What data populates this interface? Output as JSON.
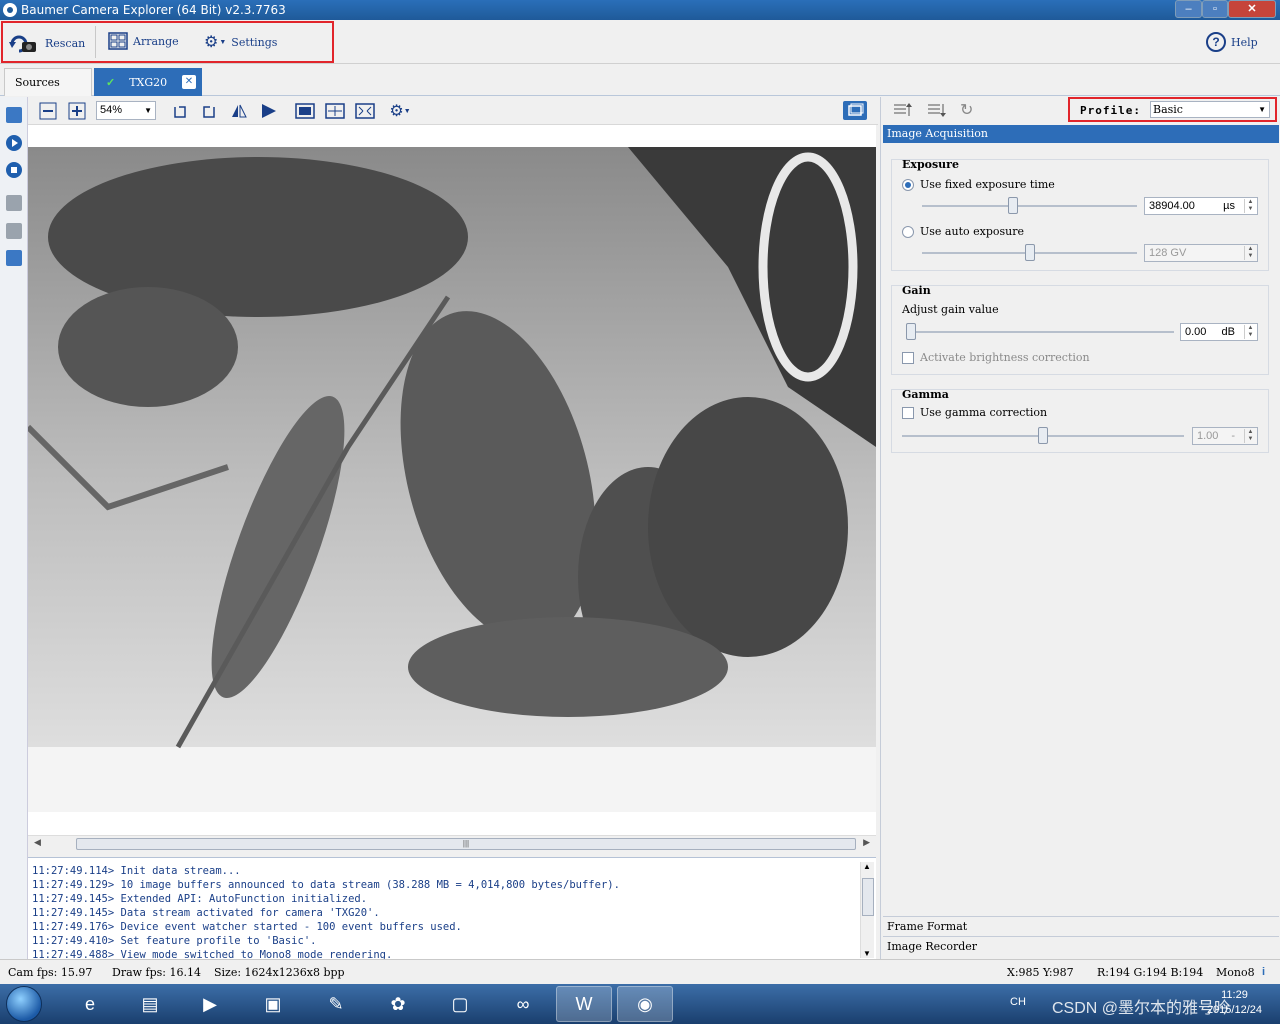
{
  "window": {
    "title": "Baumer Camera Explorer (64 Bit) v2.3.7763"
  },
  "toolbar": {
    "rescan": "Rescan",
    "arrange": "Arrange",
    "settings": "Settings",
    "help": "Help"
  },
  "tabs": {
    "sources": "Sources",
    "camera": "TXG20"
  },
  "view": {
    "zoom": "54%"
  },
  "log": [
    "11:27:49.114> Init data stream...",
    "11:27:49.129> 10 image buffers announced to data stream (38.288 MB = 4,014,800 bytes/buffer).",
    "11:27:49.145> Extended API: AutoFunction initialized.",
    "11:27:49.145> Data stream activated for camera 'TXG20'.",
    "11:27:49.176> Device event watcher started - 100 event buffers used.",
    "11:27:49.410> Set feature profile to 'Basic'.",
    "11:27:49.488> View mode switched to Mono8 mode rendering."
  ],
  "panel": {
    "profile_label": "Profile:",
    "profile_value": "Basic",
    "section": "Image Acquisition",
    "exposure": {
      "title": "Exposure",
      "fixed_label": "Use fixed exposure time",
      "fixed_value": "38904.00",
      "fixed_unit": "µs",
      "fixed_level": 0.42,
      "auto_label": "Use auto exposure",
      "auto_value": "128 GV",
      "auto_level": 0.5
    },
    "gain": {
      "title": "Gain",
      "adjust_label": "Adjust gain value",
      "value": "0.00",
      "unit": "dB",
      "level": 0.0,
      "brightness_label": "Activate brightness correction"
    },
    "gamma": {
      "title": "Gamma",
      "use_label": "Use gamma correction",
      "value": "1.00",
      "unit": "-",
      "level": 0.5
    },
    "frame_format": "Frame Format",
    "image_recorder": "Image Recorder"
  },
  "status": {
    "cam_fps": "Cam fps: 15.97",
    "draw_fps": "Draw fps: 16.14",
    "size": "Size: 1624x1236x8 bpp",
    "coords": "X:985 Y:987",
    "rgb": "R:194 G:194 B:194",
    "mode": "Mono8"
  },
  "taskbar": {
    "lang": "CH",
    "time": "11:29",
    "date": "2015/12/24",
    "watermark": "CSDN @墨尔本的雅号吟"
  },
  "colors": {
    "accent": "#2d6db8",
    "highlight": "#e1252b"
  }
}
